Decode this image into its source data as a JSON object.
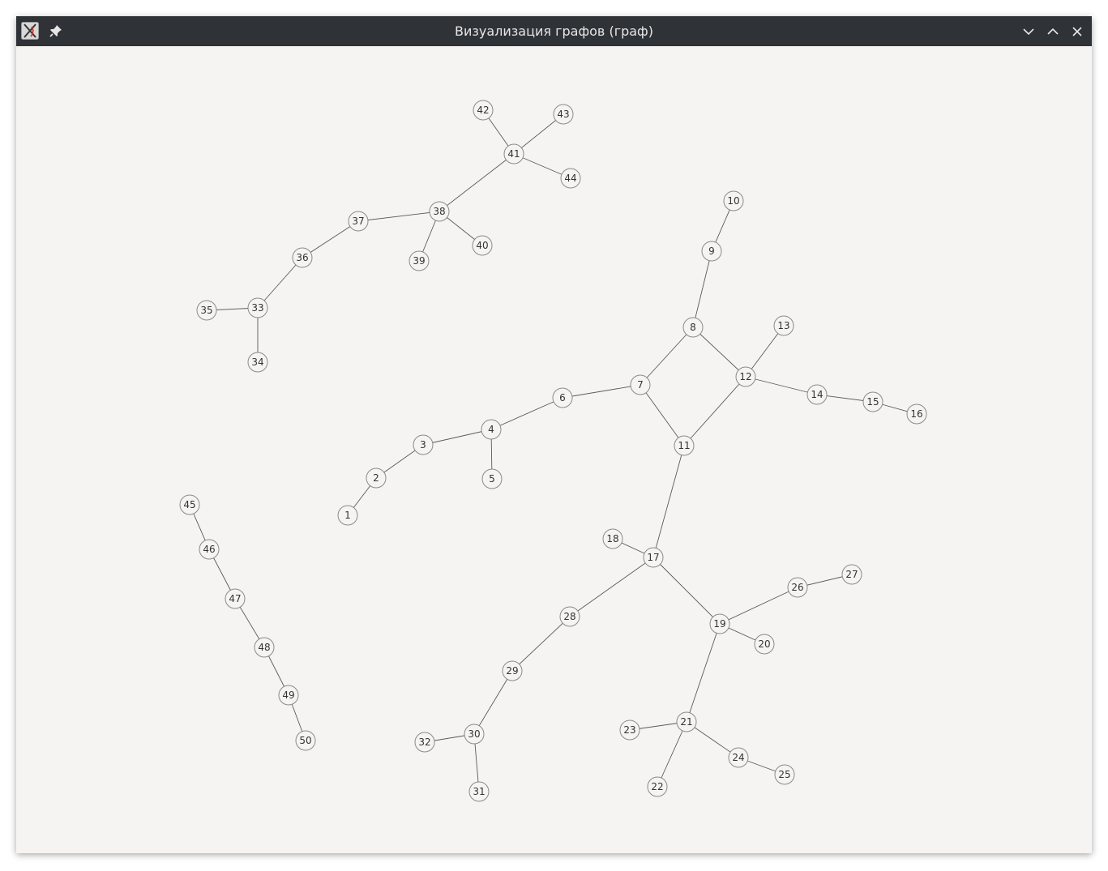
{
  "window": {
    "title": "Визуализация графов (граф)",
    "icons": {
      "app": "app-logo-icon",
      "pin": "pin-icon",
      "minimize": "chevron-down-icon",
      "maximize": "chevron-up-icon",
      "close": "close-icon"
    }
  },
  "graph": {
    "node_fill": "#f5f4f2",
    "node_stroke": "#8a8a8a",
    "edge_color": "#5a5a5a",
    "nodes": [
      {
        "id": "1"
      },
      {
        "id": "2"
      },
      {
        "id": "3"
      },
      {
        "id": "4"
      },
      {
        "id": "5"
      },
      {
        "id": "6"
      },
      {
        "id": "7"
      },
      {
        "id": "8"
      },
      {
        "id": "9"
      },
      {
        "id": "10"
      },
      {
        "id": "11"
      },
      {
        "id": "12"
      },
      {
        "id": "13"
      },
      {
        "id": "14"
      },
      {
        "id": "15"
      },
      {
        "id": "16"
      },
      {
        "id": "17"
      },
      {
        "id": "18"
      },
      {
        "id": "19"
      },
      {
        "id": "20"
      },
      {
        "id": "21"
      },
      {
        "id": "22"
      },
      {
        "id": "23"
      },
      {
        "id": "24"
      },
      {
        "id": "25"
      },
      {
        "id": "26"
      },
      {
        "id": "27"
      },
      {
        "id": "28"
      },
      {
        "id": "29"
      },
      {
        "id": "30"
      },
      {
        "id": "31"
      },
      {
        "id": "32"
      },
      {
        "id": "33"
      },
      {
        "id": "34"
      },
      {
        "id": "35"
      },
      {
        "id": "36"
      },
      {
        "id": "37"
      },
      {
        "id": "38"
      },
      {
        "id": "39"
      },
      {
        "id": "40"
      },
      {
        "id": "41"
      },
      {
        "id": "42"
      },
      {
        "id": "43"
      },
      {
        "id": "44"
      },
      {
        "id": "45"
      },
      {
        "id": "46"
      },
      {
        "id": "47"
      },
      {
        "id": "48"
      },
      {
        "id": "49"
      },
      {
        "id": "50"
      }
    ],
    "edges": [
      [
        "1",
        "2"
      ],
      [
        "2",
        "3"
      ],
      [
        "3",
        "4"
      ],
      [
        "4",
        "5"
      ],
      [
        "4",
        "6"
      ],
      [
        "6",
        "7"
      ],
      [
        "7",
        "8"
      ],
      [
        "8",
        "9"
      ],
      [
        "9",
        "10"
      ],
      [
        "7",
        "11"
      ],
      [
        "8",
        "12"
      ],
      [
        "11",
        "12"
      ],
      [
        "12",
        "13"
      ],
      [
        "12",
        "14"
      ],
      [
        "14",
        "15"
      ],
      [
        "15",
        "16"
      ],
      [
        "11",
        "17"
      ],
      [
        "17",
        "18"
      ],
      [
        "17",
        "19"
      ],
      [
        "19",
        "20"
      ],
      [
        "19",
        "21"
      ],
      [
        "21",
        "22"
      ],
      [
        "21",
        "23"
      ],
      [
        "21",
        "24"
      ],
      [
        "24",
        "25"
      ],
      [
        "19",
        "26"
      ],
      [
        "26",
        "27"
      ],
      [
        "17",
        "28"
      ],
      [
        "28",
        "29"
      ],
      [
        "29",
        "30"
      ],
      [
        "30",
        "31"
      ],
      [
        "30",
        "32"
      ],
      [
        "33",
        "34"
      ],
      [
        "33",
        "35"
      ],
      [
        "33",
        "36"
      ],
      [
        "36",
        "37"
      ],
      [
        "37",
        "38"
      ],
      [
        "38",
        "39"
      ],
      [
        "38",
        "40"
      ],
      [
        "38",
        "41"
      ],
      [
        "41",
        "42"
      ],
      [
        "41",
        "43"
      ],
      [
        "41",
        "44"
      ],
      [
        "45",
        "46"
      ],
      [
        "46",
        "47"
      ],
      [
        "47",
        "48"
      ],
      [
        "48",
        "49"
      ],
      [
        "49",
        "50"
      ]
    ]
  }
}
